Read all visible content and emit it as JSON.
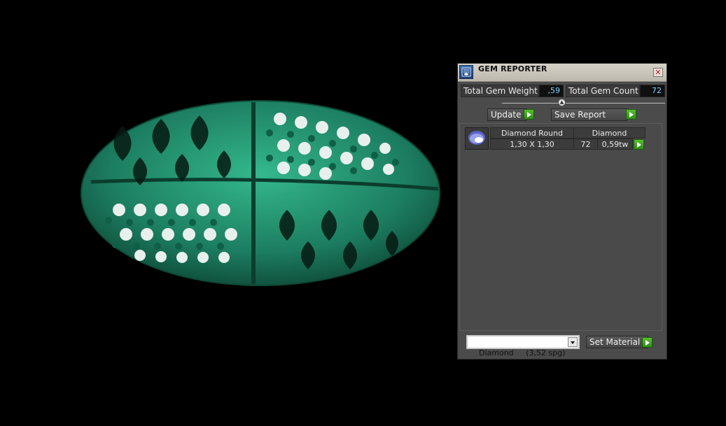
{
  "viewport": {
    "model_color": "#1f8a68"
  },
  "panel": {
    "title": "GEM REPORTER",
    "close_icon": "close-icon",
    "total_gem_weight_label": "Total Gem Weight",
    "total_gem_weight_value": ",59",
    "total_gem_count_label": "Total Gem Count",
    "total_gem_count_value": "72",
    "update_label": "Update",
    "save_report_label": "Save Report",
    "list": {
      "columns": [
        "Diamond Round",
        "Diamond"
      ],
      "rows": [
        {
          "size": "1,30 X 1,30",
          "count": "72",
          "weight": "0,59tw"
        }
      ]
    },
    "material_select": "Diamond     (3,52 spg)",
    "set_material_label": "Set Material",
    "accent_green": "#3fa321"
  }
}
